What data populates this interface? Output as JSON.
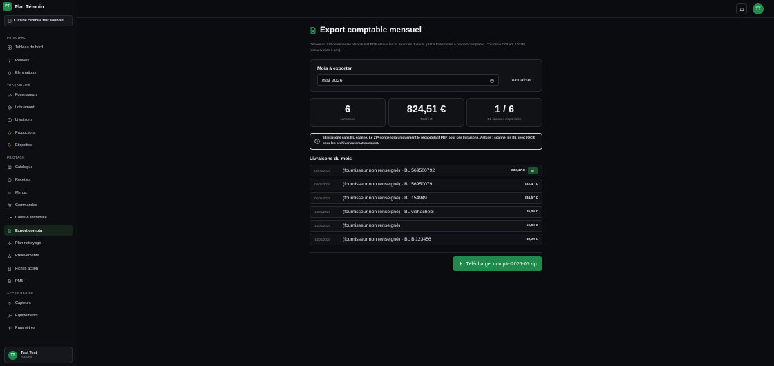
{
  "app": {
    "logo_text": "PT",
    "name": "Plat Témoin"
  },
  "tenant": {
    "label": "Cuisine centrale test soubise"
  },
  "sidebar": {
    "sections": [
      "PRINCIPAL",
      "TRAÇABILITÉ",
      "PILOTAGE",
      "ACCÈS RAPIDE"
    ],
    "items": [
      {
        "label": "Tableau de bord",
        "icon": "layout-grid-icon"
      },
      {
        "label": "Relevés",
        "icon": "thermometer-icon"
      },
      {
        "label": "Éliminations",
        "icon": "trash-icon"
      },
      {
        "label": "Fournisseurs",
        "icon": "truck-icon"
      },
      {
        "label": "Lots amont",
        "icon": "box-icon"
      },
      {
        "label": "Livraisons",
        "icon": "package-icon"
      },
      {
        "label": "Productions",
        "icon": "chef-icon"
      },
      {
        "label": "Étiquettes",
        "icon": "tag-icon"
      },
      {
        "label": "Catalogue",
        "icon": "book-icon"
      },
      {
        "label": "Recettes",
        "icon": "clipboard-icon"
      },
      {
        "label": "Menus",
        "icon": "menu-icon"
      },
      {
        "label": "Commandes",
        "icon": "cart-icon"
      },
      {
        "label": "Coûts & rentabilité",
        "icon": "trending-up-icon"
      },
      {
        "label": "Export compta",
        "icon": "file-export-icon"
      },
      {
        "label": "Plan nettoyage",
        "icon": "sparkles-icon"
      },
      {
        "label": "Prélèvements",
        "icon": "flask-icon"
      },
      {
        "label": "Fiches action",
        "icon": "alert-file-icon"
      },
      {
        "label": "PMS",
        "icon": "document-icon"
      },
      {
        "label": "Capteurs",
        "icon": "wifi-icon"
      },
      {
        "label": "Équipements",
        "icon": "wrench-icon"
      },
      {
        "label": "Paramètres",
        "icon": "gear-icon"
      }
    ]
  },
  "user": {
    "initials": "TT",
    "name": "Test Test",
    "role": "OWNER"
  },
  "topbar": {
    "avatar_initials": "TT"
  },
  "page": {
    "title": "Export comptable mensuel",
    "description": "Génère un ZIP contenant le récapitulatif PDF et tous les BL scannés du mois, prêt à transmettre à l'expert-comptable. Conforme CGI art. L102B (conservation 6 ans)."
  },
  "month_picker": {
    "label": "Mois à exporter",
    "value": "mai 2026",
    "refresh_label": "Actualiser"
  },
  "stats": [
    {
      "value": "6",
      "label": "Livraisons"
    },
    {
      "value": "824,51 €",
      "label": "Total HT"
    },
    {
      "value": "1 / 6",
      "label": "BL scannés disponibles"
    }
  ],
  "alert": {
    "text": "5 livraisons sans BL scanné. Le ZIP contiendra uniquement le récapitulatif PDF pour ces livraisons. Astuce : scanne tes BL avec l'OCR pour les archiver automatiquement."
  },
  "deliveries": {
    "title": "Livraisons du mois",
    "rows": [
      {
        "date": "04/05/2026",
        "label": "(fournisseur non renseigné) · BL 569500792",
        "amount": "232,47 €",
        "badge": "BL"
      },
      {
        "date": "04/05/2026",
        "label": "(fournisseur non renseigné) · BL 56950079",
        "amount": "232,47 €",
        "badge": null
      },
      {
        "date": "05/05/2026",
        "label": "(fournisseur non renseigné) · BL 154949",
        "amount": "284,57 €",
        "badge": null
      },
      {
        "date": "18/05/2026",
        "label": "(fournisseur non renseigné) · BL viahachebl",
        "amount": "25,00 €",
        "badge": null
      },
      {
        "date": "18/05/2026",
        "label": "(fournisseur non renseigné)",
        "amount": "10,00 €",
        "badge": null
      },
      {
        "date": "18/05/2026",
        "label": "(fournisseur non renseigné) · BL Bl123456",
        "amount": "40,00 €",
        "badge": null
      }
    ]
  },
  "download": {
    "label": "Télécharger compta-2026-05.zip"
  },
  "colors": {
    "accent": "#1f8a4c",
    "background": "#0b0c0f",
    "card": "#101216",
    "border": "#262a31"
  }
}
